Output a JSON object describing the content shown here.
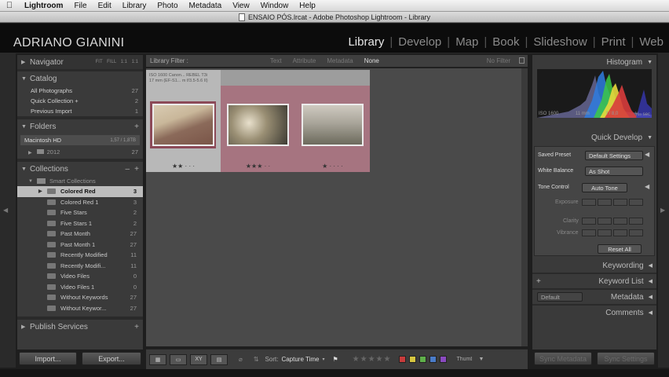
{
  "menubar": {
    "app_name": "Lightroom",
    "items": [
      "File",
      "Edit",
      "Library",
      "Photo",
      "Metadata",
      "View",
      "Window",
      "Help"
    ]
  },
  "window_title": "ENSAIO PÓS.lrcat - Adobe Photoshop Lightroom - Library",
  "identity_plate": "ADRIANO GIANINI",
  "modules": [
    "Library",
    "Develop",
    "Map",
    "Book",
    "Slideshow",
    "Print",
    "Web"
  ],
  "navigator": {
    "title": "Navigator",
    "zoom_options": [
      "FIT",
      "FILL",
      "1:1",
      "1:1"
    ]
  },
  "catalog": {
    "title": "Catalog",
    "items": [
      {
        "label": "All Photographs",
        "count": "27"
      },
      {
        "label": "Quick Collection +",
        "count": "2"
      },
      {
        "label": "Previous Import",
        "count": "1"
      }
    ]
  },
  "folders": {
    "title": "Folders",
    "volume": {
      "label": "Macintosh HD",
      "size": "1,57 / 1,8TB"
    },
    "items": [
      {
        "label": "2012",
        "count": "27"
      }
    ]
  },
  "collections": {
    "title": "Collections",
    "group": "Smart Collections",
    "items": [
      {
        "label": "Colored Red",
        "count": "3"
      },
      {
        "label": "Colored Red 1",
        "count": "3"
      },
      {
        "label": "Five Stars",
        "count": "2"
      },
      {
        "label": "Five Stars 1",
        "count": "2"
      },
      {
        "label": "Past Month",
        "count": "27"
      },
      {
        "label": "Past Month 1",
        "count": "27"
      },
      {
        "label": "Recently Modified",
        "count": "11"
      },
      {
        "label": "Recently Modifi...",
        "count": "11"
      },
      {
        "label": "Video Files",
        "count": "0"
      },
      {
        "label": "Video Files 1",
        "count": "0"
      },
      {
        "label": "Without Keywords",
        "count": "27"
      },
      {
        "label": "Without Keywor...",
        "count": "27"
      }
    ]
  },
  "publish_services": {
    "title": "Publish Services"
  },
  "left_buttons": {
    "import": "Import...",
    "export": "Export..."
  },
  "filter_bar": {
    "title": "Library Filter :",
    "tabs": [
      "Text",
      "Attribute",
      "Metadata",
      "None"
    ],
    "preset": "No Filter"
  },
  "grid": {
    "cells": [
      {
        "meta_line1": "ISO 1600     Canon...  REBEL T3i",
        "meta_line2": "17 mm (EF-S1... m f/3.5-5.6 II)",
        "stars": "★★ · · ·",
        "photo_colors": [
          "#c9b79a",
          "#7a5548"
        ]
      },
      {
        "meta_line1": "",
        "meta_line2": "",
        "stars": "★★★ · ·",
        "photo_colors": [
          "#9a8f74",
          "#3d3b33"
        ]
      },
      {
        "meta_line1": "",
        "meta_line2": "",
        "stars": "★ · · · ·",
        "photo_colors": [
          "#a9a59a",
          "#6c6a5c"
        ]
      }
    ]
  },
  "toolbar": {
    "sort_label": "Sort:",
    "sort_value": "Capture Time",
    "stars": "★★★★★",
    "thumbnails_label": "Thumbnails",
    "label_colors": [
      "#c83c3c",
      "#d6c640",
      "#5fb04a",
      "#4a7cc8",
      "#8a4ac0"
    ]
  },
  "right": {
    "histogram_title": "Histogram",
    "histogram_info": [
      "ISO 1600",
      "11 mm",
      "f / 8,0",
      "⅒ sec"
    ],
    "quick_develop": "Quick Develop",
    "saved_preset_label": "Saved Preset",
    "saved_preset_value": "Default Settings",
    "white_balance_label": "White Balance",
    "white_balance_value": "As Shot",
    "tone_control_label": "Tone Control",
    "auto_tone": "Auto Tone",
    "exposure": "Exposure",
    "clarity": "Clarity",
    "vibrance": "Vibrance",
    "reset_all": "Reset All",
    "keywording": "Keywording",
    "keyword_list": "Keyword List",
    "metadata_preset": "Default",
    "metadata": "Metadata",
    "comments": "Comments",
    "sync_metadata": "Sync Metadata",
    "sync_settings": "Sync Settings"
  }
}
